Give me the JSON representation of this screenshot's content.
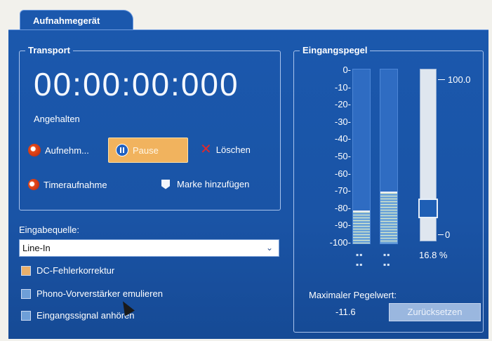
{
  "tab": {
    "label": "Aufnahmegerät"
  },
  "transport": {
    "title": "Transport",
    "timecode": "00:00:00:000",
    "status": "Angehalten",
    "record_label": "Aufnehm...",
    "pause_label": "Pause",
    "delete_label": "Löschen",
    "timer_label": "Timeraufnahme",
    "marker_label": "Marke hinzufügen"
  },
  "input": {
    "source_label": "Eingabequelle:",
    "source_value": "Line-In",
    "checkboxes": [
      {
        "label": "DC-Fehlerkorrektur"
      },
      {
        "label": "Phono-Vorverstärker emulieren"
      },
      {
        "label": "Eingangssignal anhören"
      }
    ]
  },
  "levels": {
    "title": "Eingangspegel",
    "scale": [
      "0-",
      "-10-",
      "-20-",
      "-30-",
      "-40-",
      "-50-",
      "-60-",
      "-70-",
      "-80-",
      "-90-",
      "-100-"
    ],
    "meter_left_fraction": 0.18,
    "meter_right_fraction": 0.29,
    "slider_max": "100.0",
    "slider_min": "0",
    "slider_value": "16.8 %",
    "max_label": "Maximaler Pegelwert:",
    "max_value": "-11.6",
    "reset_label": "Zurücksetzen"
  },
  "colors": {
    "panel": "#1b58ad",
    "pause_active": "#f1b35e",
    "delete_x": "#e0292b"
  }
}
